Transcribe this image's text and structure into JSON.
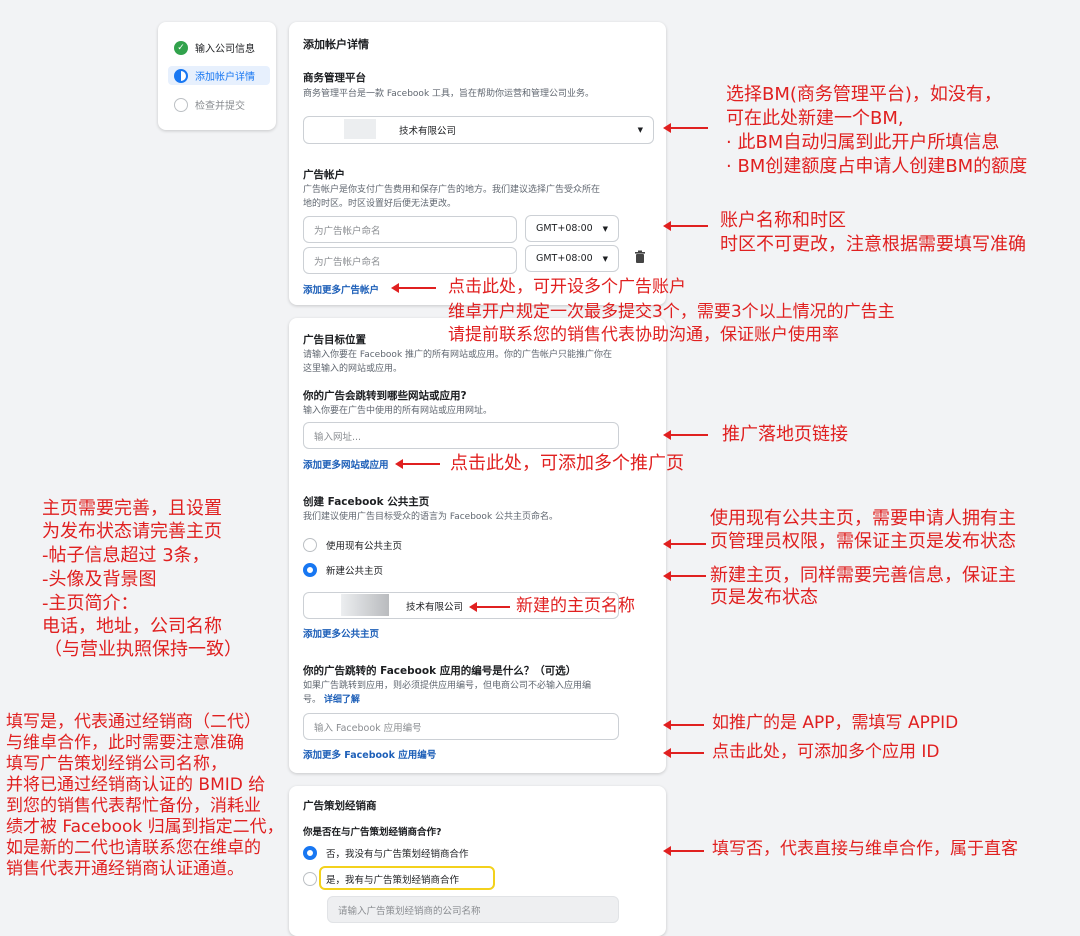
{
  "steps": [
    {
      "label": "输入公司信息",
      "state": "done"
    },
    {
      "label": "添加帐户详情",
      "state": "active"
    },
    {
      "label": "检查并提交",
      "state": "todo"
    }
  ],
  "card1": {
    "title": "添加帐户详情",
    "bm_heading": "商务管理平台",
    "bm_desc": "商务管理平台是一款 Facebook 工具，旨在帮助你运营和管理公司业务。",
    "bm_value": "技术有限公司",
    "ad_heading": "广告帐户",
    "ad_desc_1": "广告帐户是你支付广告费用和保存广告的地方。我们建议选择广告受众所在",
    "ad_desc_2": "地的时区。时区设置好后便无法更改。",
    "ad_name_placeholder": "为广告帐户命名",
    "timezone": "GMT+08:00",
    "add_more_accounts": "添加更多广告帐户"
  },
  "card2": {
    "location_heading": "广告目标位置",
    "location_desc_1": "请输入你要在 Facebook 推广的所有网站或应用。你的广告帐户只能推广你在",
    "location_desc_2": "这里输入的网站或应用。",
    "website_heading": "你的广告会跳转到哪些网站或应用?",
    "website_desc": "输入你要在广告中使用的所有网站或应用网址。",
    "url_placeholder": "输入网址...",
    "add_more_sites": "添加更多网站或应用",
    "page_heading": "创建 Facebook 公共主页",
    "page_desc": "我们建议使用广告目标受众的语言为 Facebook 公共主页命名。",
    "use_existing": "使用现有公共主页",
    "create_new": "新建公共主页",
    "page_name_value": "技术有限公司",
    "add_more_pages": "添加更多公共主页",
    "app_heading": "你的广告跳转的 Facebook 应用的编号是什么？（可选）",
    "app_desc_1": "如果广告跳转到应用，则必须提供应用编号，但电商公司不必输入应用编",
    "app_desc_2": "号。",
    "learn_more": "详细了解",
    "app_placeholder": "输入 Facebook 应用编号",
    "add_more_apps": "添加更多 Facebook 应用编号"
  },
  "card3": {
    "agency_heading": "广告策划经销商",
    "agency_question": "你是否在与广告策划经销商合作?",
    "option_no": "否，我没有与广告策划经销商合作",
    "option_yes": "是，我有与广告策划经销商合作",
    "agency_placeholder": "请输入广告策划经销商的公司名称"
  },
  "annotations": {
    "bm_1": "选择BM(商务管理平台)，如没有，",
    "bm_2": "可在此处新建一个BM,",
    "bm_3": "· 此BM自动归属到此开户所填信息",
    "bm_4": "· BM创建额度占申请人创建BM的额度",
    "account_1": "账户名称和时区",
    "account_2": "时区不可更改，注意根据需要填写准确",
    "more_1": "点击此处，可开设多个广告账户",
    "more_2": "维卓开户规定一次最多提交3个，需要3个以上情况的广告主",
    "more_3": "请提前联系您的销售代表协助沟通，保证账户使用率",
    "landing": "推广落地页链接",
    "more_sites": "点击此处，可添加多个推广页",
    "existing_1": "使用现有公共主页，需要申请人拥有主",
    "existing_2": "页管理员权限，需保证主页是发布状态",
    "new_1": "新建主页，同样需要完善信息，保证主",
    "new_2": "页是发布状态",
    "page_name": "新建的主页名称",
    "left_1": "主页需要完善，且设置",
    "left_2": "为发布状态请完善主页",
    "left_3": "-帖子信息超过 3条，",
    "left_4": "-头像及背景图",
    "left_5": "-主页简介：",
    "left_6": "电话，地址，公司名称",
    "left_7": "（与营业执照保持一致）",
    "app_id": "如推广的是 APP，需填写 APPID",
    "more_apps": "点击此处，可添加多个应用 ID",
    "agency_left_1": "填写是，代表通过经销商（二代）",
    "agency_left_2": "与维卓合作，此时需要注意准确",
    "agency_left_3": "填写广告策划经销公司名称，",
    "agency_left_4": "并将已通过经销商认证的 BMID 给",
    "agency_left_5": "到您的销售代表帮忙备份，消耗业",
    "agency_left_6": "绩才被 Facebook 归属到指定二代，",
    "agency_left_7": "如是新的二代也请联系您在维卓的",
    "agency_left_8": "销售代表开通经销商认证通道。",
    "direct": "填写否，代表直接与维卓合作，属于直客"
  }
}
